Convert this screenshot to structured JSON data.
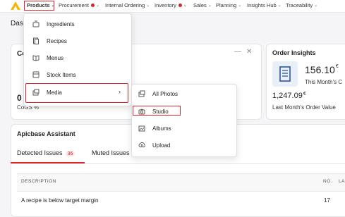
{
  "nav": {
    "items": [
      {
        "label": "Products",
        "alert": false
      },
      {
        "label": "Procurement",
        "alert": true
      },
      {
        "label": "Internal Ordering",
        "alert": false
      },
      {
        "label": "Inventory",
        "alert": true
      },
      {
        "label": "Sales",
        "alert": false
      },
      {
        "label": "Planning",
        "alert": false
      },
      {
        "label": "Insights Hub",
        "alert": false
      },
      {
        "label": "Traceability",
        "alert": false
      }
    ],
    "brand_color": "#f2b705"
  },
  "page": {
    "title": "Dash"
  },
  "cogs_card": {
    "title": "Co",
    "value": "0",
    "label": "CoGS %"
  },
  "order_insights": {
    "title": "Order Insights",
    "this_month_value": "156.10",
    "currency": "€",
    "this_month_label": "This Month's C",
    "last_month_value": "1,247.09",
    "last_month_label": "Last Month's Order Value"
  },
  "assistant": {
    "title": "Apicbase Assistant",
    "tabs": [
      {
        "label": "Detected Issues",
        "count": "36"
      },
      {
        "label": "Muted Issues",
        "count": ""
      }
    ],
    "columns": [
      "DESCRIPTION",
      "NO.",
      "LA"
    ],
    "rows": [
      {
        "description": "A recipe is below target margin",
        "no": "17"
      }
    ]
  },
  "products_menu": {
    "items": [
      {
        "label": "Ingredients",
        "icon": "ingredients-icon"
      },
      {
        "label": "Recipes",
        "icon": "recipes-icon"
      },
      {
        "label": "Menus",
        "icon": "menus-icon"
      },
      {
        "label": "Stock Items",
        "icon": "stock-items-icon"
      },
      {
        "label": "Media",
        "icon": "media-icon"
      }
    ]
  },
  "media_submenu": {
    "items": [
      {
        "label": "All Photos",
        "icon": "photos-icon"
      },
      {
        "label": "Studio",
        "icon": "camera-icon"
      },
      {
        "label": "Albums",
        "icon": "albums-icon"
      },
      {
        "label": "Upload",
        "icon": "upload-icon"
      }
    ]
  },
  "colors": {
    "accent": "#d9262c",
    "highlight_box": "#d9262c"
  }
}
